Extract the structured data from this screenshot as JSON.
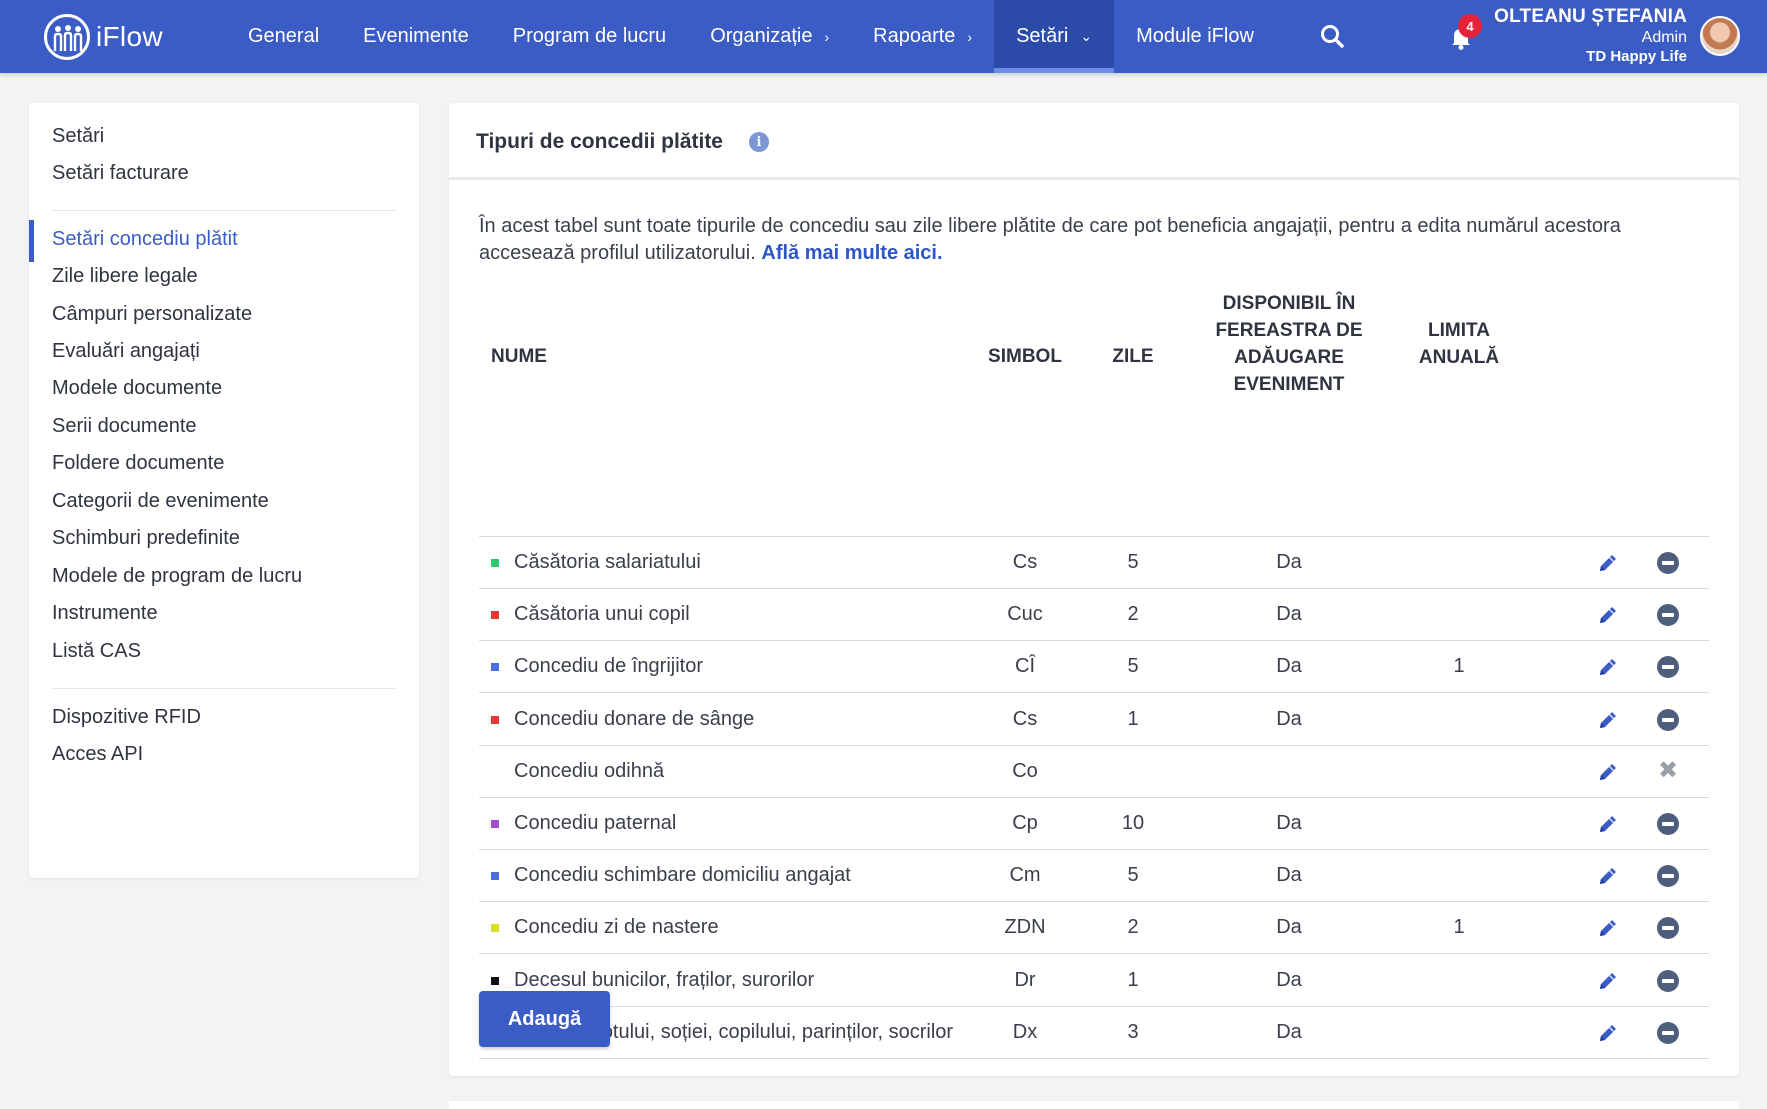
{
  "app": {
    "name": "iFlow"
  },
  "nav": {
    "items": [
      {
        "label": "General",
        "chevron": false,
        "active": false
      },
      {
        "label": "Evenimente",
        "chevron": false,
        "active": false
      },
      {
        "label": "Program de lucru",
        "chevron": false,
        "active": false
      },
      {
        "label": "Organizație",
        "chevron": "›",
        "active": false
      },
      {
        "label": "Rapoarte",
        "chevron": "›",
        "active": false
      },
      {
        "label": "Setări",
        "chevron": "⌄",
        "active": true
      },
      {
        "label": "Module iFlow",
        "chevron": false,
        "active": false
      }
    ]
  },
  "notifications": {
    "count": "4"
  },
  "user": {
    "name": "OLTEANU ȘTEFANIA",
    "role": "Admin",
    "company": "TD Happy Life"
  },
  "sidebar": {
    "group1": [
      "Setări",
      "Setări facturare"
    ],
    "group2": [
      "Setări concediu plătit",
      "Zile libere legale",
      "Câmpuri personalizate",
      "Evaluări angajați",
      "Modele documente",
      "Serii documente",
      "Foldere documente",
      "Categorii de evenimente",
      "Schimburi predefinite",
      "Modele de program de lucru",
      "Instrumente",
      "Listă CAS"
    ],
    "group3": [
      "Dispozitive RFID",
      "Acces API"
    ],
    "active": "Setări concediu plătit"
  },
  "panel": {
    "title": "Tipuri de concedii plătite",
    "info": "i",
    "description": "În acest tabel sunt toate tipurile de concediu sau zile libere plătite de care pot beneficia angajații, pentru a edita numărul acestora accesează profilul utilizatorului.",
    "link": "Află mai multe aici."
  },
  "table": {
    "headers": {
      "name": "NUME",
      "symbol": "SIMBOL",
      "days": "ZILE",
      "available": [
        "DISPONIBIL ÎN",
        "FEREASTRA DE",
        "ADĂUGARE",
        "EVENIMENT"
      ],
      "limit": [
        "LIMITA",
        "ANUALĂ"
      ]
    },
    "rows": [
      {
        "name": "Căsătoria salariatului",
        "symbol": "Cs",
        "days": "5",
        "available": "Da",
        "limit": "",
        "color": "#2ecc71",
        "removable": true
      },
      {
        "name": "Căsătoria unui copil",
        "symbol": "Cuc",
        "days": "2",
        "available": "Da",
        "limit": "",
        "color": "#e53935",
        "removable": true
      },
      {
        "name": "Concediu de îngrijitor",
        "symbol": "CÎ",
        "days": "5",
        "available": "Da",
        "limit": "1",
        "color": "#4a6ee0",
        "removable": true
      },
      {
        "name": "Concediu donare de sânge",
        "symbol": "Cs",
        "days": "1",
        "available": "Da",
        "limit": "",
        "color": "#e53935",
        "removable": true
      },
      {
        "name": "Concediu odihnă",
        "symbol": "Co",
        "days": "",
        "available": "",
        "limit": "",
        "color": "",
        "removable": false
      },
      {
        "name": "Concediu paternal",
        "symbol": "Cp",
        "days": "10",
        "available": "Da",
        "limit": "",
        "color": "#a24dc9",
        "removable": true
      },
      {
        "name": "Concediu schimbare domiciliu angajat",
        "symbol": "Cm",
        "days": "5",
        "available": "Da",
        "limit": "",
        "color": "#4a6ee0",
        "removable": true
      },
      {
        "name": "Concediu zi de nastere",
        "symbol": "ZDN",
        "days": "2",
        "available": "Da",
        "limit": "1",
        "color": "#d4e22b",
        "removable": true
      },
      {
        "name": "Decesul bunicilor, fraților, surorilor",
        "symbol": "Dr",
        "days": "1",
        "available": "Da",
        "limit": "",
        "color": "#111111",
        "removable": true
      },
      {
        "name": "Decesul sotului, soției, copilului, parinților, socrilor",
        "symbol": "Dx",
        "days": "3",
        "available": "Da",
        "limit": "",
        "color": "#2ecc71",
        "removable": true
      }
    ]
  },
  "actions": {
    "add": "Adaugă"
  },
  "colors": {
    "primary": "#3b5cc4",
    "nav_active": "#2c4aa8",
    "badge": "#e6223a"
  }
}
